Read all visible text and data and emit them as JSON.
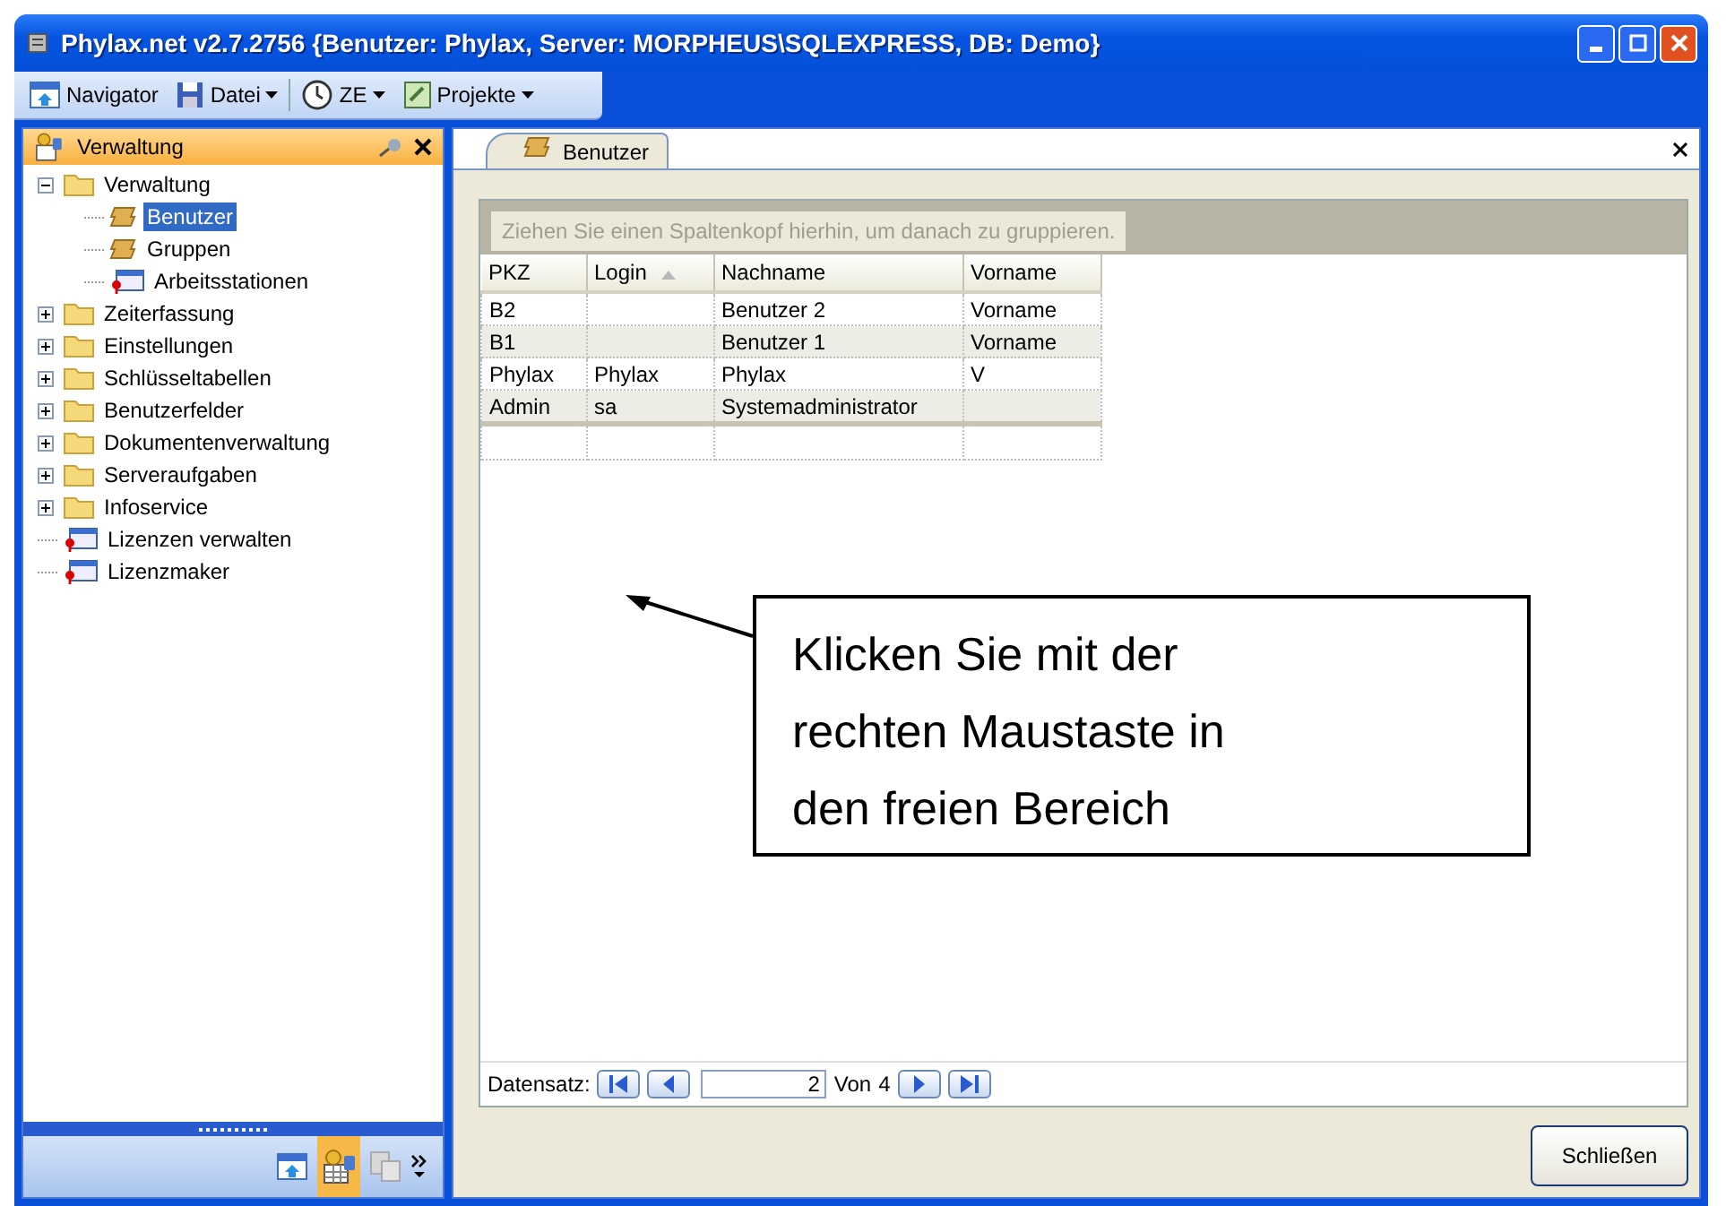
{
  "window": {
    "title": "Phylax.net v2.7.2756 {Benutzer: Phylax, Server: MORPHEUS\\SQLEXPRESS, DB: Demo}"
  },
  "toolbar": [
    {
      "label": "Navigator",
      "kind": "navigator",
      "dropdown": false
    },
    {
      "label": "Datei",
      "kind": "save",
      "dropdown": true
    },
    {
      "label": "ZE",
      "kind": "clock",
      "dropdown": true
    },
    {
      "label": "Projekte",
      "kind": "project",
      "dropdown": true
    }
  ],
  "sidebar": {
    "title": "Verwaltung",
    "tree": [
      {
        "label": "Verwaltung",
        "kind": "folder",
        "expanded": true,
        "selected": false,
        "children": [
          {
            "label": "Benutzer",
            "kind": "user",
            "selected": true
          },
          {
            "label": "Gruppen",
            "kind": "user",
            "selected": false
          },
          {
            "label": "Arbeitsstationen",
            "kind": "station",
            "selected": false
          }
        ]
      },
      {
        "label": "Zeiterfassung",
        "kind": "folder",
        "expanded": false,
        "selected": false
      },
      {
        "label": "Einstellungen",
        "kind": "folder",
        "expanded": false,
        "selected": false
      },
      {
        "label": "Schlüsseltabellen",
        "kind": "folder",
        "expanded": false,
        "selected": false
      },
      {
        "label": "Benutzerfelder",
        "kind": "folder",
        "expanded": false,
        "selected": false
      },
      {
        "label": "Dokumentenverwaltung",
        "kind": "folder",
        "expanded": false,
        "selected": false
      },
      {
        "label": "Serveraufgaben",
        "kind": "folder",
        "expanded": false,
        "selected": false
      },
      {
        "label": "Infoservice",
        "kind": "folder",
        "expanded": false,
        "selected": false
      },
      {
        "label": "Lizenzen verwalten",
        "kind": "station",
        "selected": false
      },
      {
        "label": "Lizenzmaker",
        "kind": "station",
        "selected": false
      }
    ],
    "bottom_buttons": [
      {
        "kind": "navigator",
        "selected": false
      },
      {
        "kind": "admin",
        "selected": true
      },
      {
        "kind": "disabled",
        "selected": false
      }
    ]
  },
  "tabs": [
    {
      "label": "Benutzer",
      "selected": true
    }
  ],
  "grid": {
    "group_hint": "Ziehen Sie einen Spaltenkopf hierhin, um danach zu gruppieren.",
    "columns": [
      {
        "label": "PKZ",
        "sorted": false
      },
      {
        "label": "Login",
        "sorted": true
      },
      {
        "label": "Nachname",
        "sorted": false
      },
      {
        "label": "Vorname",
        "sorted": false
      }
    ],
    "rows": [
      [
        "B2",
        "",
        "Benutzer 2",
        "Vorname"
      ],
      [
        "B1",
        "",
        "Benutzer 1",
        "Vorname"
      ],
      [
        "Phylax",
        "Phylax",
        "Phylax",
        "V"
      ],
      [
        "Admin",
        "sa",
        "Systemadministrator",
        ""
      ]
    ]
  },
  "navigator": {
    "label": "Datensatz:",
    "value": "2",
    "of_label": "Von",
    "total": "4"
  },
  "annotation": {
    "text": "Klicken Sie mit der rechten Maustaste in den freien Bereich"
  },
  "buttons": [
    "Schließen"
  ]
}
